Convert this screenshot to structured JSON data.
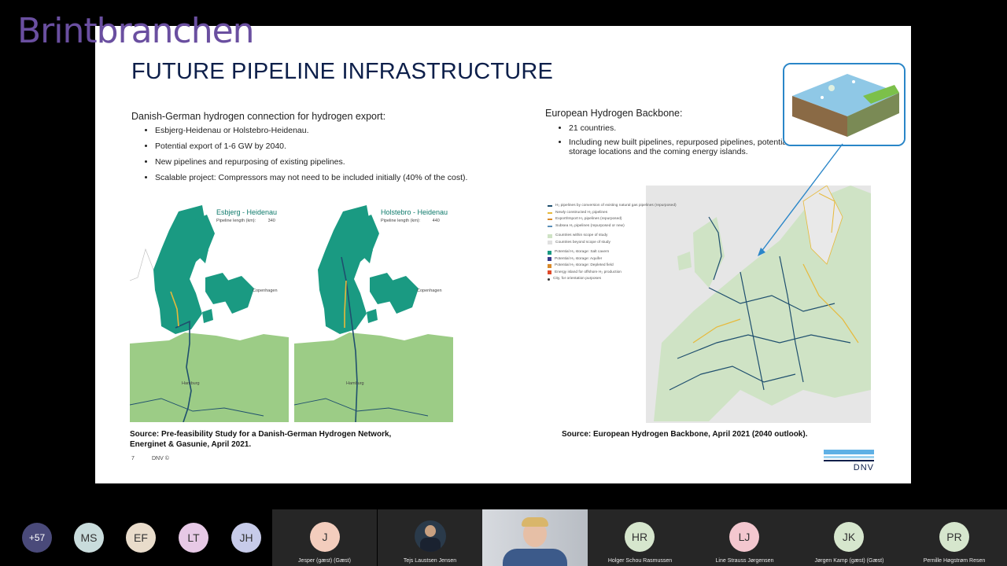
{
  "brand": "Brintbranchen",
  "slide": {
    "title": "FUTURE PIPELINE INFRASTRUCTURE",
    "left": {
      "heading": "Danish-German hydrogen connection for hydrogen export:",
      "bullets": [
        "Esbjerg-Heidenau or Holstebro-Heidenau.",
        "Potential export of 1-6 GW by 2040.",
        "New pipelines and repurposing of existing pipelines.",
        "Scalable project: Compressors may not need to be included initially (40% of the cost)."
      ],
      "map1": {
        "title": "Esbjerg - Heidenau",
        "sub_label": "Pipeline length (km):",
        "sub_value": "340"
      },
      "map2": {
        "title": "Holstebro - Heidenau",
        "sub_label": "Pipeline length (km):",
        "sub_value": "440"
      },
      "city_copenhagen": "Copenhagen",
      "city_hamburg": "Hamburg",
      "source_line1": "Source: Pre-feasibility Study for a Danish-German Hydrogen Network,",
      "source_line2": "Energinet & Gasunie, April 2021."
    },
    "right": {
      "heading": "European Hydrogen Backbone:",
      "bullets": [
        "21 countries.",
        "Including new built pipelines, repurposed pipelines, potential storage locations and the coming energy islands."
      ],
      "legend": [
        "H₂ pipelines by conversion of existing natural gas pipelines (repurposed)",
        "Newly constructed H₂ pipelines",
        "Export/Import H₂ pipelines (repurposed)",
        "Subsea H₂ pipelines (repurposed or new)",
        "Countries within scope of study",
        "Countries beyond scope of study",
        "Potential H₂ storage: Salt cavern",
        "Potential H₂ storage: Aquifer",
        "Potential H₂ storage: Depleted field",
        "Energy island for offshore H₂ production",
        "City, for orientation purposes"
      ],
      "source": "Source: European Hydrogen Backbone, April 2021 (2040 outlook)."
    },
    "page_number": "7",
    "copyright": "DNV ©",
    "logo": "DNV"
  },
  "participants": [
    {
      "initials": "+57",
      "color": "#4a4a7a",
      "name": ""
    },
    {
      "initials": "MS",
      "color": "#c9dcdc",
      "name": ""
    },
    {
      "initials": "EF",
      "color": "#e9dccb",
      "name": ""
    },
    {
      "initials": "LT",
      "color": "#e7c9e6",
      "name": ""
    },
    {
      "initials": "JH",
      "color": "#c7cbe9",
      "name": ""
    },
    {
      "initials": "J",
      "color": "#f3cdbd",
      "name": "Jesper (gæst) (Gæst)"
    },
    {
      "initials": "",
      "color": "",
      "name": "Tejs Laustsen Jensen"
    },
    {
      "initials": "",
      "color": "",
      "name": ""
    },
    {
      "initials": "HR",
      "color": "#d6e6cd",
      "name": "Holger Schou Rasmussen"
    },
    {
      "initials": "LJ",
      "color": "#f3c7cf",
      "name": "Line Strauss Jørgensen"
    },
    {
      "initials": "JK",
      "color": "#d6e6cd",
      "name": "Jørgen Kamp (gæst) (Gæst)"
    },
    {
      "initials": "PR",
      "color": "#d6e6cd",
      "name": "Pernille Høgstrøm Resen"
    }
  ]
}
